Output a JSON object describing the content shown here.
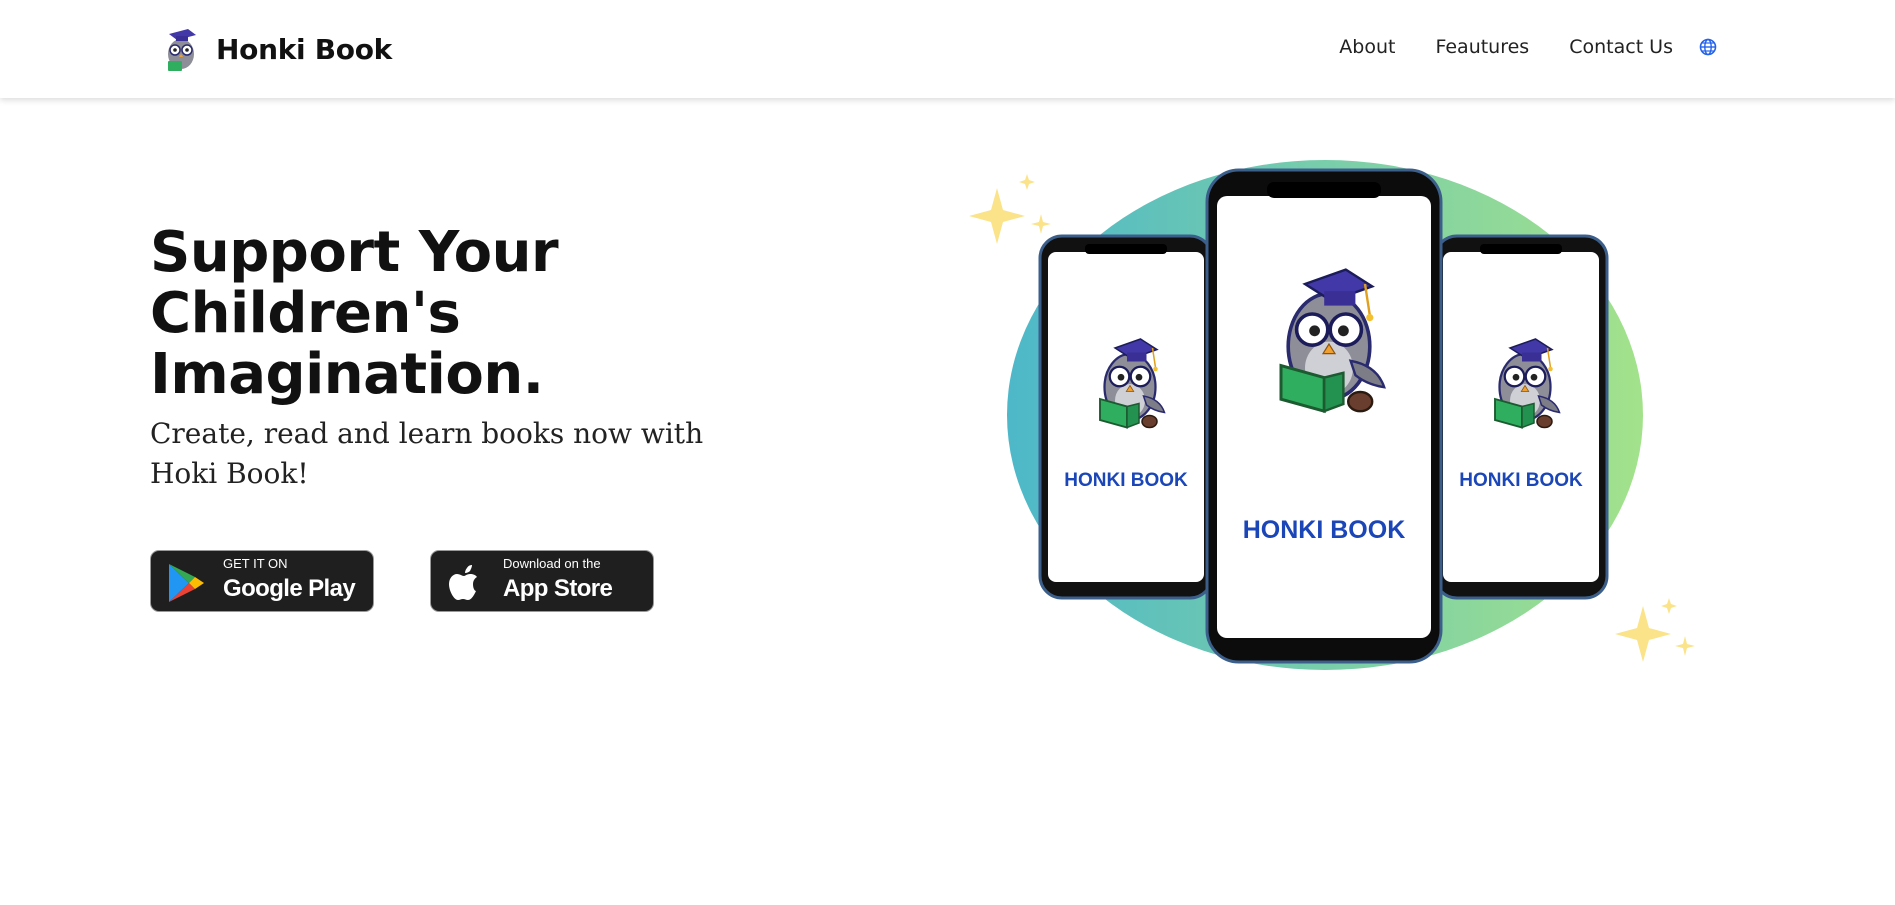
{
  "header": {
    "brand_name": "Honki Book",
    "nav": [
      "About",
      "Feautures",
      "Contact Us"
    ]
  },
  "hero": {
    "title": "Support Your Children's Imagination.",
    "subtitle": "Create, read and learn books now with Hoki Book!"
  },
  "store_buttons": {
    "google_play": {
      "small": "GET IT ON",
      "big": "Google Play"
    },
    "app_store": {
      "small": "Download on the",
      "big": "App Store"
    }
  },
  "phones": {
    "screen_label": "HONKI BOOK"
  },
  "icons": {
    "brand_logo": "owl-logo-icon",
    "language": "globe-icon",
    "google_play": "google-play-icon",
    "app_store": "apple-icon"
  },
  "colors": {
    "nav_globe": "#2563eb",
    "button_bg": "#1f1f1f",
    "blob_left": "#4db8c9",
    "blob_right": "#a3e28b",
    "sparkle": "#fbe38a",
    "phone_label": "#1b46b8"
  }
}
